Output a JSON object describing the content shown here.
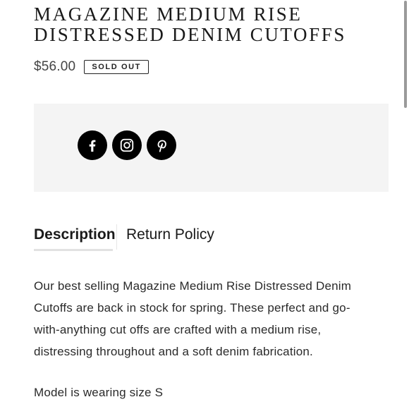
{
  "product": {
    "title_lines": [
      "MAGAZINE MEDIUM RISE",
      "DISTRESSED DENIM CUTOFFS"
    ],
    "price": "$56.00",
    "status_badge": "SOLD OUT"
  },
  "share": {
    "icons": [
      "facebook-icon",
      "instagram-icon",
      "pinterest-icon"
    ],
    "icon_bg_color": "#000000",
    "panel_bg_color": "#f4f4f4"
  },
  "tabs": [
    {
      "label": "Description",
      "active": true
    },
    {
      "label": "Return Policy",
      "active": false
    }
  ],
  "description": {
    "lines": [
      "Our best selling Magazine Medium Rise Distressed Denim",
      "Cutoffs are back in stock for spring. These perfect and go-",
      "with-anything cut offs are crafted with a medium rise,",
      "distressing throughout and a soft denim fabrication."
    ],
    "model_note": "Model is wearing size S"
  }
}
